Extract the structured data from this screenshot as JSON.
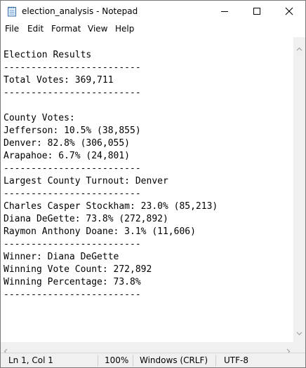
{
  "window": {
    "title": "election_analysis - Notepad"
  },
  "menu": {
    "items": [
      "File",
      "Edit",
      "Format",
      "View",
      "Help"
    ]
  },
  "document": {
    "lines": [
      "",
      "Election Results",
      "-------------------------",
      "Total Votes: 369,711",
      "-------------------------",
      "",
      "County Votes:",
      "Jefferson: 10.5% (38,855)",
      "Denver: 82.8% (306,055)",
      "Arapahoe: 6.7% (24,801)",
      "-------------------------",
      "Largest County Turnout: Denver",
      "-------------------------",
      "Charles Casper Stockham: 23.0% (85,213)",
      "Diana DeGette: 73.8% (272,892)",
      "Raymon Anthony Doane: 3.1% (11,606)",
      "-------------------------",
      "Winner: Diana DeGette",
      "Winning Vote Count: 272,892",
      "Winning Percentage: 73.8%",
      "-------------------------"
    ]
  },
  "status": {
    "position": "Ln 1, Col 1",
    "zoom": "100%",
    "line_ending": "Windows (CRLF)",
    "encoding": "UTF-8"
  },
  "icons": {
    "app": "notepad-icon",
    "minimize": "minimize-icon",
    "maximize": "maximize-icon",
    "close": "close-icon"
  }
}
